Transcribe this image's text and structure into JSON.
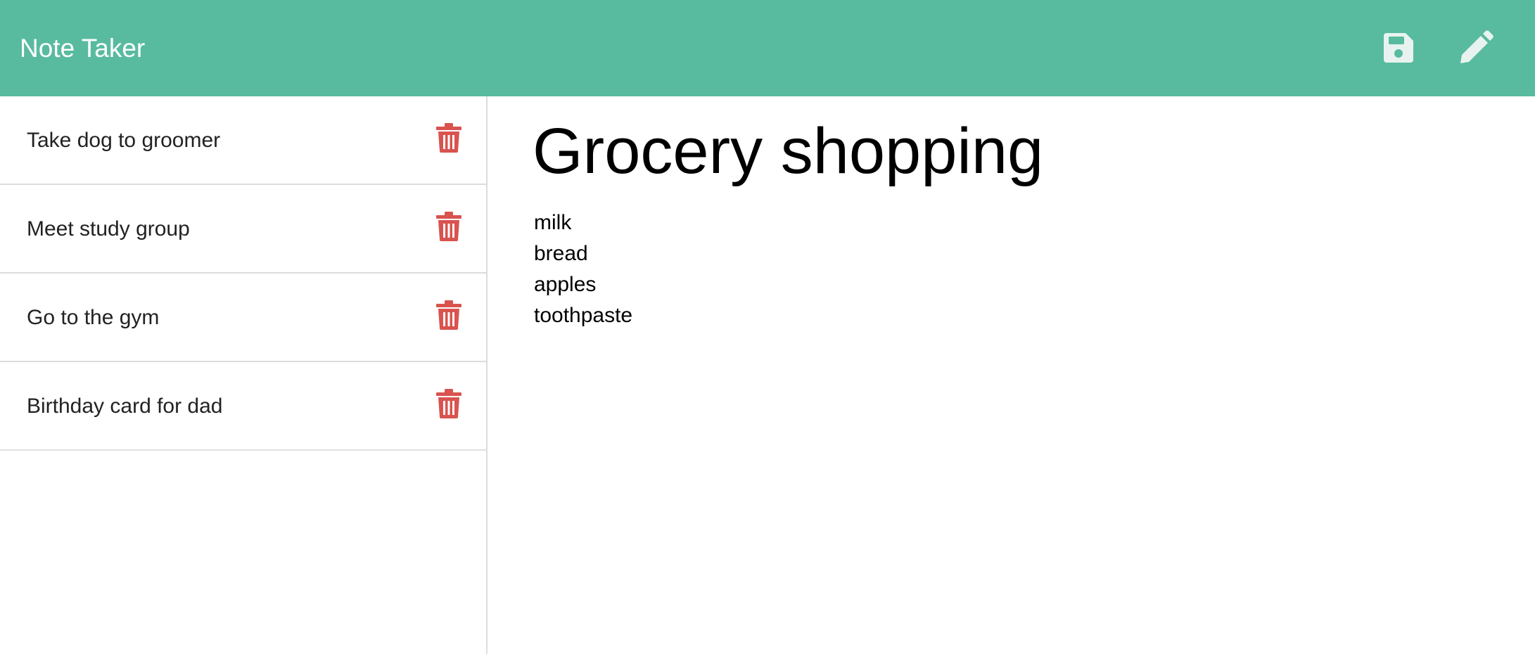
{
  "app": {
    "title": "Note Taker"
  },
  "toolbar": {
    "save_icon": "floppy-disk-icon",
    "edit_icon": "pencil-icon"
  },
  "sidebar": {
    "items": [
      {
        "label": "Take dog to groomer",
        "icon": "trash-icon"
      },
      {
        "label": "Meet study group",
        "icon": "trash-icon"
      },
      {
        "label": "Go to the gym",
        "icon": "trash-icon"
      },
      {
        "label": "Birthday card for dad",
        "icon": "trash-icon"
      }
    ]
  },
  "note": {
    "title": "Grocery shopping",
    "body": "milk\nbread\napples\ntoothpaste"
  },
  "colors": {
    "navbar": "#58bb9f",
    "delete": "#d9534f",
    "nav_icon": "#ffffff"
  }
}
